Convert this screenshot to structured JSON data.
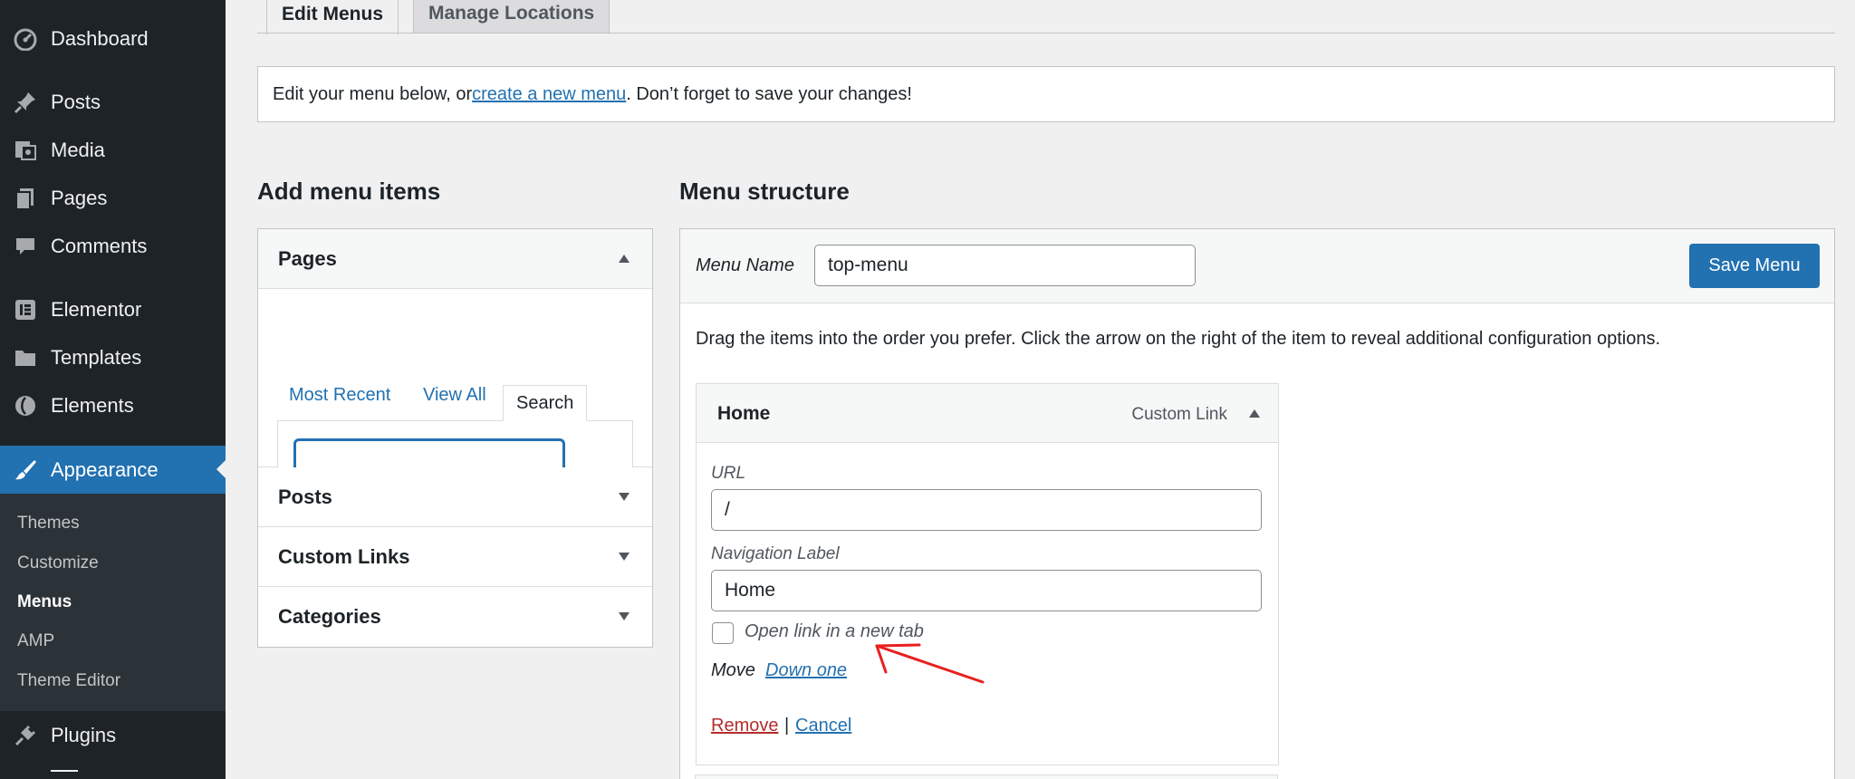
{
  "sidebar": {
    "items": [
      {
        "label": "Dashboard",
        "icon": "dashboard-icon"
      },
      {
        "label": "Posts",
        "icon": "pin-icon"
      },
      {
        "label": "Media",
        "icon": "media-icon"
      },
      {
        "label": "Pages",
        "icon": "pages-icon"
      },
      {
        "label": "Comments",
        "icon": "comment-icon"
      },
      {
        "label": "Elementor",
        "icon": "elementor-icon"
      },
      {
        "label": "Templates",
        "icon": "folder-icon"
      },
      {
        "label": "Elements",
        "icon": "elements-icon"
      },
      {
        "label": "Appearance",
        "icon": "brush-icon"
      },
      {
        "label": "Plugins",
        "icon": "plug-icon"
      }
    ],
    "submenu": [
      "Themes",
      "Customize",
      "Menus",
      "AMP",
      "Theme Editor"
    ]
  },
  "tabs": {
    "edit_menus": "Edit Menus",
    "manage_locations": "Manage Locations"
  },
  "notice": {
    "before": "Edit your menu below, or ",
    "link": "create a new menu",
    "after": ". Don’t forget to save your changes!"
  },
  "add_items": {
    "heading": "Add menu items",
    "sections": [
      "Pages",
      "Posts",
      "Custom Links",
      "Categories"
    ],
    "inner_tabs": [
      "Most Recent",
      "View All",
      "Search"
    ],
    "search_value": ""
  },
  "structure": {
    "heading": "Menu structure",
    "menu_name_label": "Menu Name",
    "menu_name_value": "top-menu",
    "save_button": "Save Menu",
    "drag_hint": "Drag the items into the order you prefer. Click the arrow on the right of the item to reveal additional configuration options.",
    "item": {
      "title": "Home",
      "type": "Custom Link",
      "url_label": "URL",
      "url_value": "/",
      "nav_label_label": "Navigation Label",
      "nav_label_value": "Home",
      "new_tab_label": "Open link in a new tab",
      "move_label": "Move",
      "move_down": "Down one",
      "remove": "Remove",
      "separator": "|",
      "cancel": "Cancel"
    }
  },
  "colors": {
    "accent": "#2271b1",
    "sidebar": "#1d2327",
    "danger": "#b32d2e",
    "annotation": "#e8201e"
  }
}
